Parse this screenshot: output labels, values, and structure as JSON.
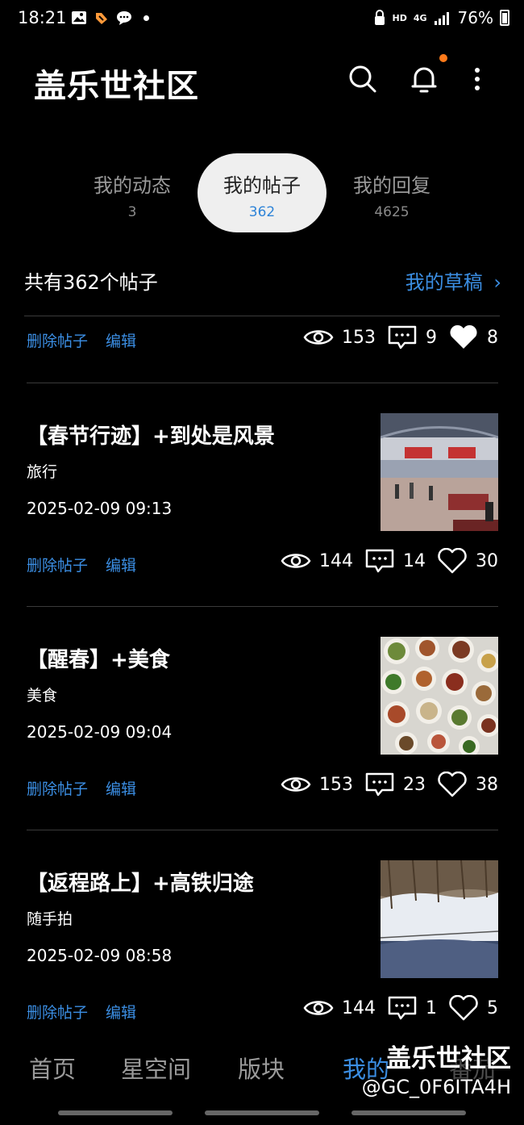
{
  "status_bar": {
    "time": "18:21",
    "network_hd": "HD",
    "network_4g": "4G",
    "battery": "76%"
  },
  "header": {
    "title": "盖乐世社区",
    "icons": [
      "search-icon",
      "bell-icon",
      "more-vertical-icon"
    ],
    "notification_dot_color": "#ff7a1a"
  },
  "tabs": [
    {
      "label": "我的动态",
      "count": "3"
    },
    {
      "label": "我的帖子",
      "count": "362",
      "active": true
    },
    {
      "label": "我的回复",
      "count": "4625"
    }
  ],
  "summary": {
    "total": "共有362个帖子",
    "drafts": "我的草稿",
    "drafts_chevron": "›"
  },
  "actions": {
    "delete": "删除帖子",
    "edit": "编辑"
  },
  "top_row": {
    "views": "153",
    "comments": "9",
    "likes": "8",
    "liked": true
  },
  "posts": [
    {
      "title": "【春节行迹】+到处是风景",
      "category": "旅行",
      "date": "2025-02-09 09:13",
      "views": "144",
      "comments": "14",
      "likes": "30",
      "thumbnail": "train-station-photo"
    },
    {
      "title": "【醒春】+美食",
      "category": "美食",
      "date": "2025-02-09 09:04",
      "views": "153",
      "comments": "23",
      "likes": "38",
      "thumbnail": "food-dishes-photo"
    },
    {
      "title": "【返程路上】+高铁归途",
      "category": "随手拍",
      "date": "2025-02-09 08:58",
      "views": "144",
      "comments": "1",
      "likes": "5",
      "thumbnail": "snowy-landscape-photo"
    }
  ],
  "bottom_nav": [
    "首页",
    "星空间",
    "版块",
    "我的",
    "番茄"
  ],
  "watermark": {
    "line1": "盖乐世社区",
    "line2": "@GC_0F6ITA4H"
  },
  "colors": {
    "accent": "#3b8ee3",
    "background": "#000000"
  }
}
